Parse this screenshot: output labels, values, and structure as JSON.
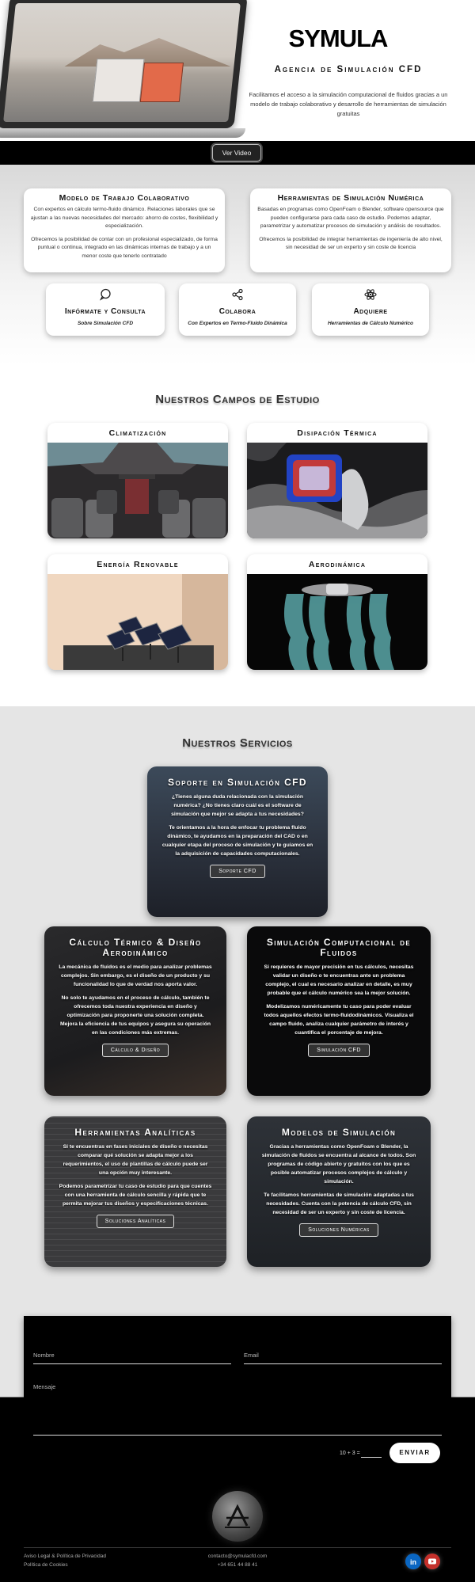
{
  "hero": {
    "brand": "SYMULA",
    "title": "Agencia de Simulación CFD",
    "description": "Facilitamos el acceso a la simulación computacional de fluidos gracias a un modelo de trabajo colaborativo y desarrollo de herramientas de simulación gratuitas",
    "video_button": "Ver Video"
  },
  "about": {
    "card1": {
      "title": "Modelo de Trabajo Colaborativo",
      "p1": "Con expertos en cálculo termo-fluido dinámico. Relaciones laborales que se ajustan a las nuevas necesidades del mercado: ahorro de costes, flexibilidad y especialización.",
      "p2": "Ofrecemos la posibilidad de contar con un profesional especializado, de forma puntual o continua, integrado en las dinámicas internas de trabajo y a un menor coste que tenerlo contratado"
    },
    "card2": {
      "title": "Herramientas de Simulación Numérica",
      "p1": "Basadas en programas como OpenFoam o Blender, software opensource que pueden configurarse para cada caso de estudio. Podemos adaptar, parametrizar y automatizar procesos de simulación y análisis de resultados.",
      "p2": "Ofrecemos la posibilidad de integrar herramientas de ingeniería de alto nivel, sin necesidad de ser un experto y sin coste de licencia"
    },
    "mini": [
      {
        "icon": "chat-icon",
        "title": "Infórmate y Consulta",
        "subtitle": "Sobre Simulación CFD"
      },
      {
        "icon": "share-icon",
        "title": "Colabora",
        "subtitle": "Con Expertos en Termo-Fluido Dinámica"
      },
      {
        "icon": "atom-icon",
        "title": "Adquiere",
        "subtitle": "Herramientas de Cálculo Numérico"
      }
    ]
  },
  "campos": {
    "title": "Nuestros Campos de Estudio",
    "items": [
      {
        "label": "Climatización"
      },
      {
        "label": "Disipación Térmica"
      },
      {
        "label": "Energía Renovable"
      },
      {
        "label": "Aerodinámica"
      }
    ]
  },
  "servicios": {
    "title": "Nuestros Servicios",
    "soporte": {
      "title": "Soporte en Simulación CFD",
      "p1": "¿Tienes alguna duda relacionada con la simulación numérica? ¿No tienes claro cuál es el software de simulación que mejor se adapta a tus necesidades?",
      "p2": "Te orientamos a la hora de enfocar tu problema fluido dinámico, te ayudamos en la preparación del CAD o en cualquier etapa del proceso de simulación y te guiamos en la adquisición de capacidades computacionales.",
      "button": "Soporte CFD"
    },
    "calculo": {
      "title": "Cálculo Térmico & Diseño Aerodinámico",
      "p1": "La mecánica de fluidos es el medio para analizar problemas complejos. Sin embargo, es el diseño de un producto y su funcionalidad lo que de verdad nos aporta valor.",
      "p2": "No solo te ayudamos en el proceso de cálculo, también te ofrecemos toda nuestra experiencia en diseño y optimización para proponerte una solución completa. Mejora la eficiencia de tus equipos y asegura su operación en las condiciones más extremas.",
      "button": "Cálculo & Diseño"
    },
    "simulacion": {
      "title": "Simulación Computacional de Fluidos",
      "p1": "Si requieres de mayor precisión en tus cálculos, necesitas validar un diseño o te encuentras ante un problema complejo, el cual es necesario analizar en detalle, es muy probable que el cálculo numérico sea la mejor solución.",
      "p2": "Modelizamos numéricamente tu caso para poder evaluar todos aquellos efectos termo-fluidodinámicos. Visualiza el campo fluido, analiza cualquier parámetro de interés y cuantifica el porcentaje de mejora.",
      "button": "Simulación CFD"
    },
    "herramientas": {
      "title": "Herramientas Analíticas",
      "p1": "Si te encuentras en fases iniciales de diseño o necesitas comparar qué solución se adapta mejor a los requerimientos, el uso de plantillas de cálculo puede ser una opción muy interesante.",
      "p2": "Podemos parametrizar tu caso de estudio para que cuentes con una herramienta de cálculo sencilla y rápida que te permita mejorar tus diseños y especificaciones técnicas.",
      "button": "Soluciones Analíticas"
    },
    "modelos": {
      "title": "Modelos de Simulación",
      "p1": "Gracias a herramientas como OpenFoam o Blender, la simulación de fluidos se encuentra al alcance de todos. Son programas de código abierto y gratuitos con los que es posible automatizar procesos complejos de cálculo y simulación.",
      "p2": "Te facilitamos herramientas de simulación adaptadas a tus necesidades. Cuenta con la potencia de cálculo CFD, sin necesidad de ser un experto y sin coste de licencia.",
      "button": "Soluciones Numéricas"
    }
  },
  "contact": {
    "name_label": "Nombre",
    "email_label": "Email",
    "message_label": "Mensaje",
    "captcha": "10 + 3 =",
    "send": "ENVIAR"
  },
  "footer": {
    "legal": "Aviso Legal & Política de Privacidad",
    "cookies": "Política de Cookies",
    "email": "contacto@symulacfd.com",
    "phone": "+34 651 44 88 41",
    "social": [
      {
        "icon": "linkedin-icon",
        "color": "#0a66c2"
      },
      {
        "icon": "youtube-icon",
        "color": "#c4302b"
      }
    ]
  }
}
